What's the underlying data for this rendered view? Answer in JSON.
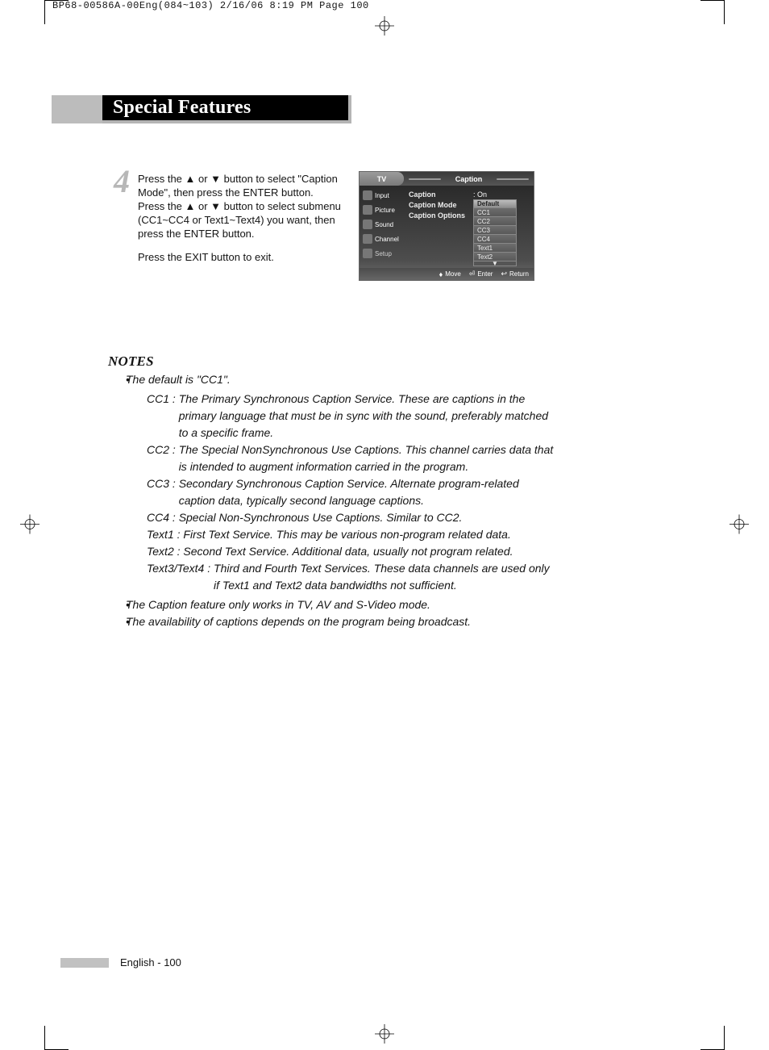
{
  "slug": "BP68-00586A-00Eng(084~103)  2/16/06  8:19 PM  Page 100",
  "header": {
    "title": "Special Features"
  },
  "step": {
    "number": "4",
    "p1": "Press the ▲ or ▼ button to select \"Caption Mode\", then press the ENTER button.",
    "p2": "Press the ▲ or ▼ button to select submenu (CC1~CC4 or Text1~Text4) you want, then press the ENTER button.",
    "p3": "Press the EXIT button to exit."
  },
  "osd": {
    "tv": "TV",
    "title": "Caption",
    "side": [
      "Input",
      "Picture",
      "Sound",
      "Channel",
      "Setup"
    ],
    "main": {
      "caption_label": "Caption",
      "caption_value": ": On",
      "mode_label": "Caption Mode",
      "options_label": "Caption Options",
      "dd": [
        "Default",
        "CC1",
        "CC2",
        "CC3",
        "CC4",
        "Text1",
        "Text2"
      ]
    },
    "foot": {
      "move": "Move",
      "enter": "Enter",
      "return": "Return"
    }
  },
  "notes": {
    "title": "NOTES",
    "b1": "The default is \"CC1\".",
    "defs": [
      {
        "term": "CC1",
        "desc": "The Primary Synchronous Caption Service. These are captions in the primary language that must be in sync with the sound, preferably matched to a specific frame."
      },
      {
        "term": "CC2",
        "desc": "The Special NonSynchronous Use Captions. This channel carries data that is intended to augment information carried in the program."
      },
      {
        "term": "CC3",
        "desc": "Secondary Synchronous Caption Service. Alternate program-related caption data, typically second language captions."
      },
      {
        "term": "CC4",
        "desc": "Special Non-Synchronous Use Captions. Similar to CC2."
      },
      {
        "term": "Text1",
        "desc": "First Text Service. This may be various non-program related data."
      },
      {
        "term": "Text2",
        "desc": "Second Text Service. Additional data, usually not program related."
      },
      {
        "term": "Text3/Text4",
        "desc": "Third and Fourth Text Services. These data channels are used only if Text1 and Text2 data bandwidths not sufficient."
      }
    ],
    "b2": "The Caption feature only works in TV, AV and S-Video mode.",
    "b3": "The availability of captions depends on the program being broadcast."
  },
  "footer": "English - 100"
}
